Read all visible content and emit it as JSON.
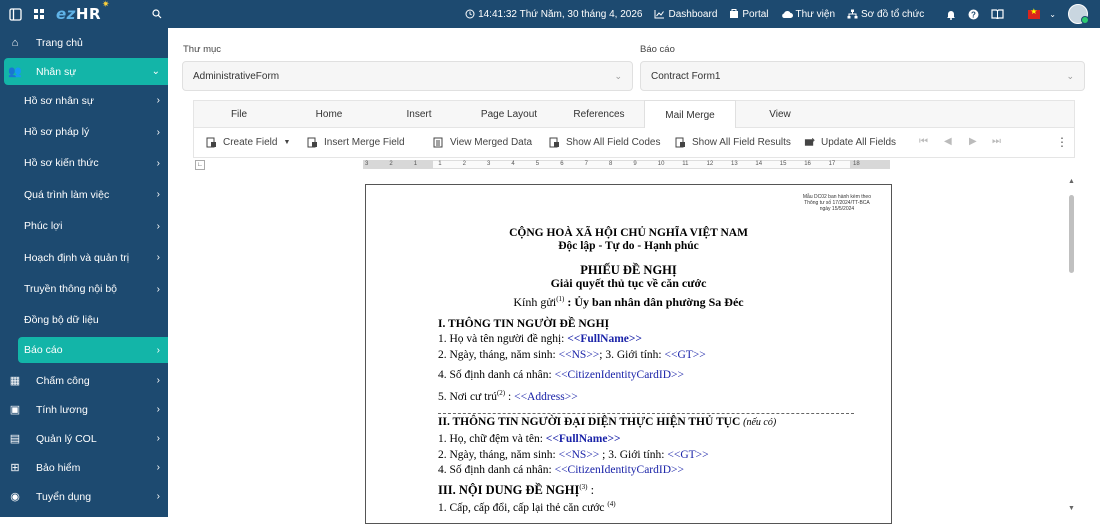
{
  "topbar": {
    "logo_prefix": "ez",
    "logo_suffix": "HR",
    "datetime": "14:41:32 Thứ Năm, 30 tháng 4, 2026",
    "dashboard": "Dashboard",
    "portal": "Portal",
    "library": "Thư viện",
    "org_chart": "Sơ đồ tổ chức"
  },
  "sidebar": {
    "items": [
      {
        "label": "Trang chủ"
      },
      {
        "label": "Nhân sự"
      },
      {
        "label": "Hồ sơ nhân sự"
      },
      {
        "label": "Hồ sơ pháp lý"
      },
      {
        "label": "Hồ sơ kiến thức"
      },
      {
        "label": "Quá trình làm việc"
      },
      {
        "label": "Phúc lợi"
      },
      {
        "label": "Hoạch định và quản trị"
      },
      {
        "label": "Truyền thông nội bộ"
      },
      {
        "label": "Đồng bộ dữ liệu"
      },
      {
        "label": "Báo cáo"
      },
      {
        "label": "Chấm công"
      },
      {
        "label": "Tính lương"
      },
      {
        "label": "Quản lý COL"
      },
      {
        "label": "Bảo hiểm"
      },
      {
        "label": "Tuyển dụng"
      }
    ]
  },
  "form": {
    "folder_label": "Thư mục",
    "folder_value": "AdministrativeForm",
    "report_label": "Báo cáo",
    "report_value": "Contract Form1"
  },
  "ribbon": {
    "tabs": [
      "File",
      "Home",
      "Insert",
      "Page Layout",
      "References",
      "Mail Merge",
      "View"
    ],
    "active_tab": "Mail Merge"
  },
  "toolbar": {
    "create_field": "Create Field",
    "insert_merge_field": "Insert Merge Field",
    "view_merged_data": "View Merged Data",
    "show_all_field_codes": "Show All Field Codes",
    "show_all_field_results": "Show All Field Results",
    "update_all_fields": "Update All Fields"
  },
  "ruler": {
    "ticks": [
      "3",
      "2",
      "1",
      "1",
      "2",
      "3",
      "4",
      "5",
      "6",
      "7",
      "8",
      "9",
      "10",
      "11",
      "12",
      "13",
      "14",
      "15",
      "16",
      "17",
      "18"
    ]
  },
  "document": {
    "corner_note_1": "Mẫu DC02 ban hành kèm theo",
    "corner_note_2": "Thông tư số 17/2024/TT-BCA",
    "corner_note_3": "ngày 15/5/2024",
    "nation": "CỘNG HOÀ XÃ HỘI CHỦ NGHĨA VIỆT NAM",
    "motto": "Độc lập - Tự do - Hạnh phúc",
    "title": "PHIẾU ĐỀ NGHỊ",
    "subtitle": "Giải quyết thủ tục về căn cước",
    "to_prefix": "Kính gửi",
    "to_sup": "(1)",
    "to_value": ": Ủy ban nhân dân phường Sa Đéc",
    "sec1": "I. THÔNG TIN NGƯỜI ĐỀ NGHỊ",
    "s1_l1": "1. Họ và tên người đề nghị:",
    "s1_l1_field": "<<FullName>>",
    "s1_l2a": "2. Ngày, tháng, năm sinh:",
    "s1_l2_ns": "<<NS>>",
    "s1_l2b": "; 3. Giới tính:",
    "s1_l2_gt": "<<GT>>",
    "s1_l3": "4. Số định danh cá nhân:",
    "s1_l3_field": "<<CitizenIdentityCardID>>",
    "s1_l4": "5. Nơi cư trú",
    "s1_l4_sup": "(2)",
    "s1_l4_colon": ":",
    "s1_l4_field": "<<Address>>",
    "sec2": "II. THÔNG TIN NGƯỜI ĐẠI DIỆN THỰC HIỆN THỦ TỤC",
    "sec2_note": "(nếu có)",
    "s2_l1": "1. Họ, chữ đệm và tên:",
    "s2_l1_field": "<<FullName>>",
    "s2_l2a": "2. Ngày, tháng, năm sinh:",
    "s2_l2_ns": "<<NS>>",
    "s2_l2b": "; 3. Giới tính:",
    "s2_l2_gt": "<<GT>>",
    "s2_l3": "4. Số định danh cá nhân:",
    "s2_l3_field": "<<CitizenIdentityCardID>>",
    "sec3": "III. NỘI DUNG ĐỀ NGHỊ",
    "sec3_sup": "(3)",
    "sec3_colon": ":",
    "s3_l1": "1. Cấp, cấp đổi, cấp lại thẻ căn cước",
    "s3_l1_sup": "(4)"
  }
}
